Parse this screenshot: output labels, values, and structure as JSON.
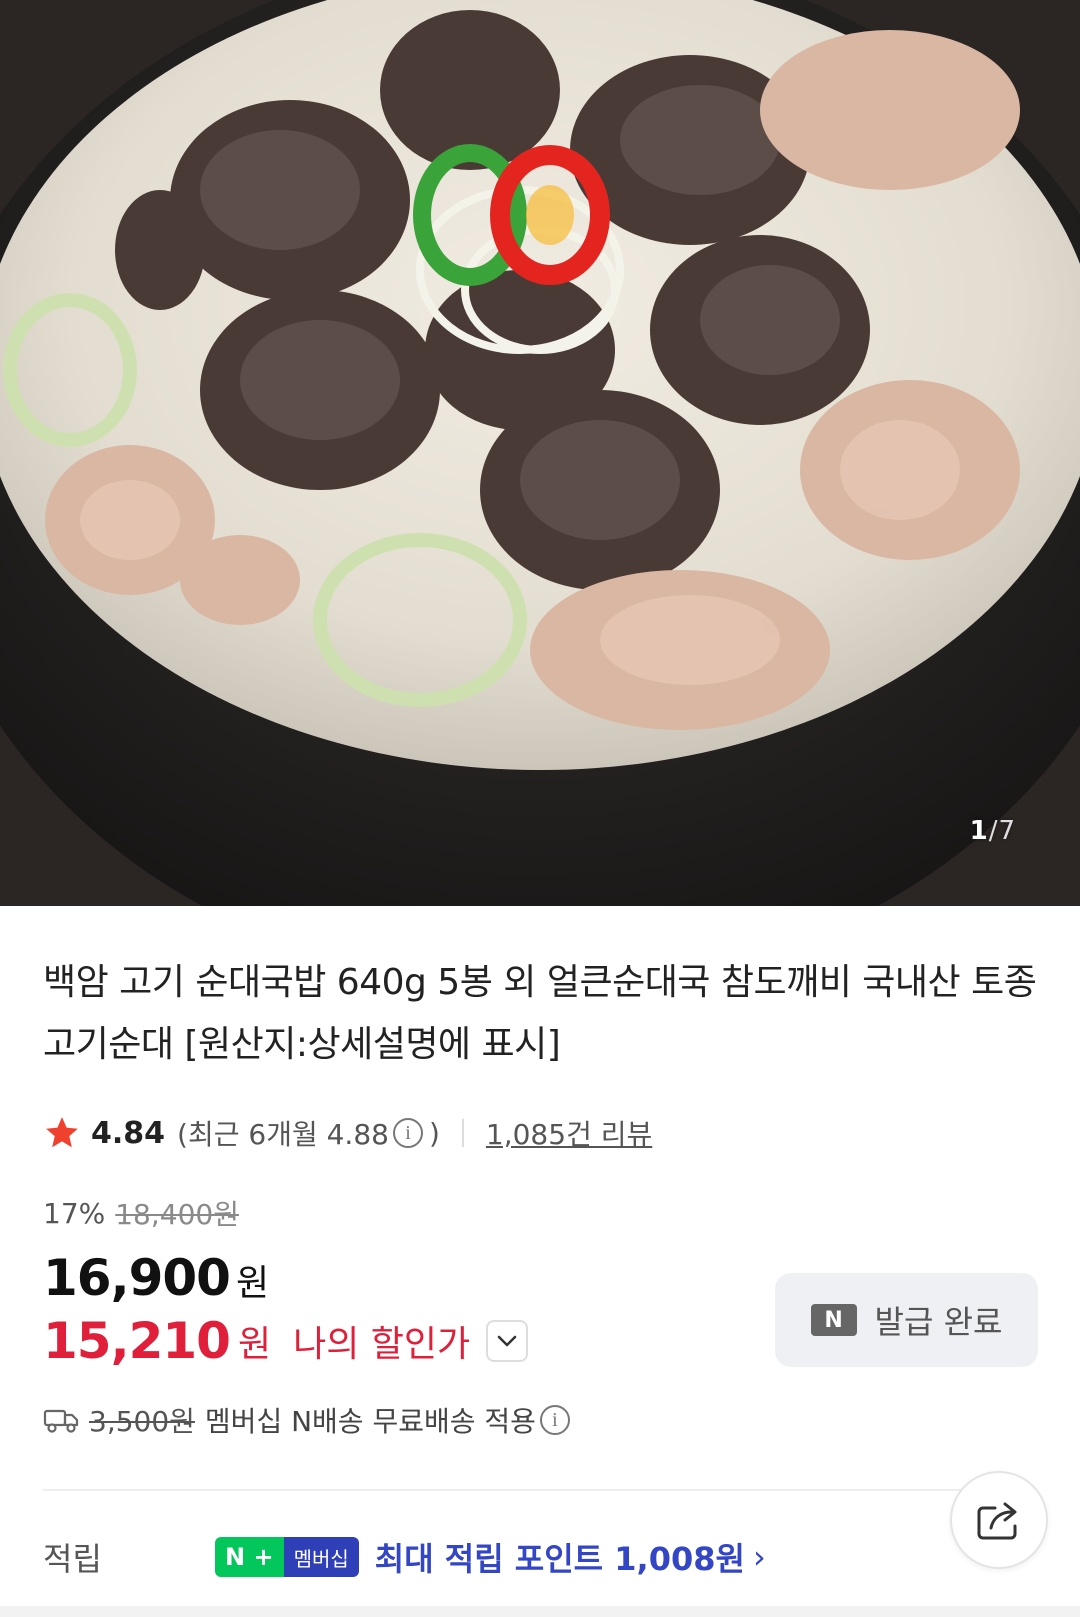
{
  "image": {
    "current": "1",
    "separator": "/",
    "total": "7"
  },
  "product": {
    "title": "백암 고기 순대국밥 640g 5봉 외 얼큰순대국 참도깨비 국내산 토종고기순대 [원산지:상세설명에 표시]"
  },
  "rating": {
    "score": "4.84",
    "recent_open": "(최근 6개월 4.88",
    "recent_close": ")",
    "reviews": "1,085건 리뷰"
  },
  "price": {
    "discount_rate": "17%",
    "original": "18,400원",
    "sale": "16,900",
    "sale_unit": "원",
    "my_price": "15,210",
    "my_unit": "원",
    "my_label": "나의 할인가"
  },
  "coupon": {
    "badge": "N",
    "label": "발급 완료"
  },
  "shipping": {
    "original_fee": "3,500원",
    "text": "멤버십 N배송 무료배송 적용"
  },
  "points": {
    "label": "적립",
    "badge_n": "N +",
    "badge_membership": "멤버십",
    "text": "최대 적립 포인트 1,008원",
    "chevron": "›"
  },
  "colors": {
    "accent_red": "#e0203a",
    "star": "#f0412f",
    "points_blue": "#3346c5",
    "naver_green": "#03c75a",
    "membership_blue": "#2f3fb7"
  },
  "icons": {
    "star": "star-icon",
    "info": "info-icon",
    "chevron": "chevron-down-icon",
    "truck": "truck-icon",
    "share": "share-icon"
  }
}
